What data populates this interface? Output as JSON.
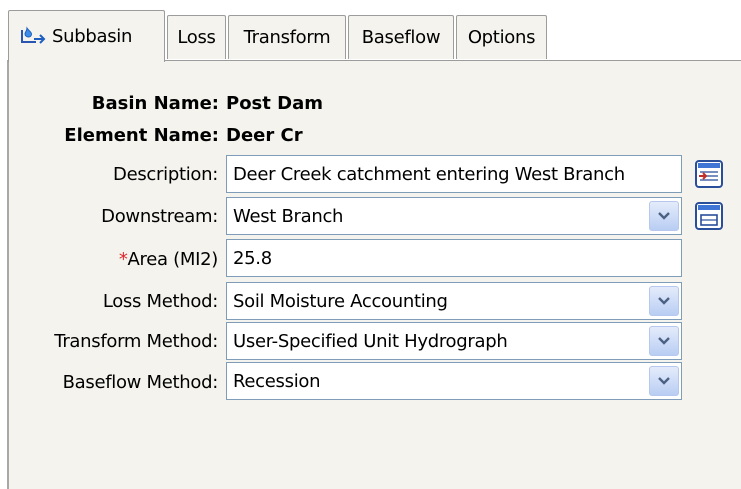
{
  "tabs": [
    {
      "label": "Subbasin",
      "active": true
    },
    {
      "label": "Loss",
      "active": false
    },
    {
      "label": "Transform",
      "active": false
    },
    {
      "label": "Baseflow",
      "active": false
    },
    {
      "label": "Options",
      "active": false
    }
  ],
  "header": {
    "basin_name_label": "Basin Name:",
    "basin_name_value": "Post Dam",
    "element_name_label": "Element Name:",
    "element_name_value": "Deer Cr"
  },
  "form": {
    "description": {
      "label": "Description:",
      "value": "Deer Creek catchment entering West Branch"
    },
    "downstream": {
      "label": "Downstream:",
      "value": "West Branch"
    },
    "area": {
      "required_marker": "*",
      "label": "Area (MI2)",
      "value": "25.8"
    },
    "loss_method": {
      "label": "Loss Method:",
      "value": "Soil Moisture Accounting"
    },
    "transform_method": {
      "label": "Transform Method:",
      "value": "User-Specified Unit Hydrograph"
    },
    "baseflow_method": {
      "label": "Baseflow Method:",
      "value": "Recession"
    }
  },
  "icons": {
    "subbasin_tab": "subbasin-icon",
    "description_button": "description-editor-icon",
    "downstream_button": "element-selector-icon",
    "dropdown": "chevron-down-icon"
  },
  "colors": {
    "panel_background": "#f4f3ed",
    "field_border": "#7f9db9",
    "required_marker": "#e0262a",
    "icon_blue": "#1f5fbf"
  }
}
